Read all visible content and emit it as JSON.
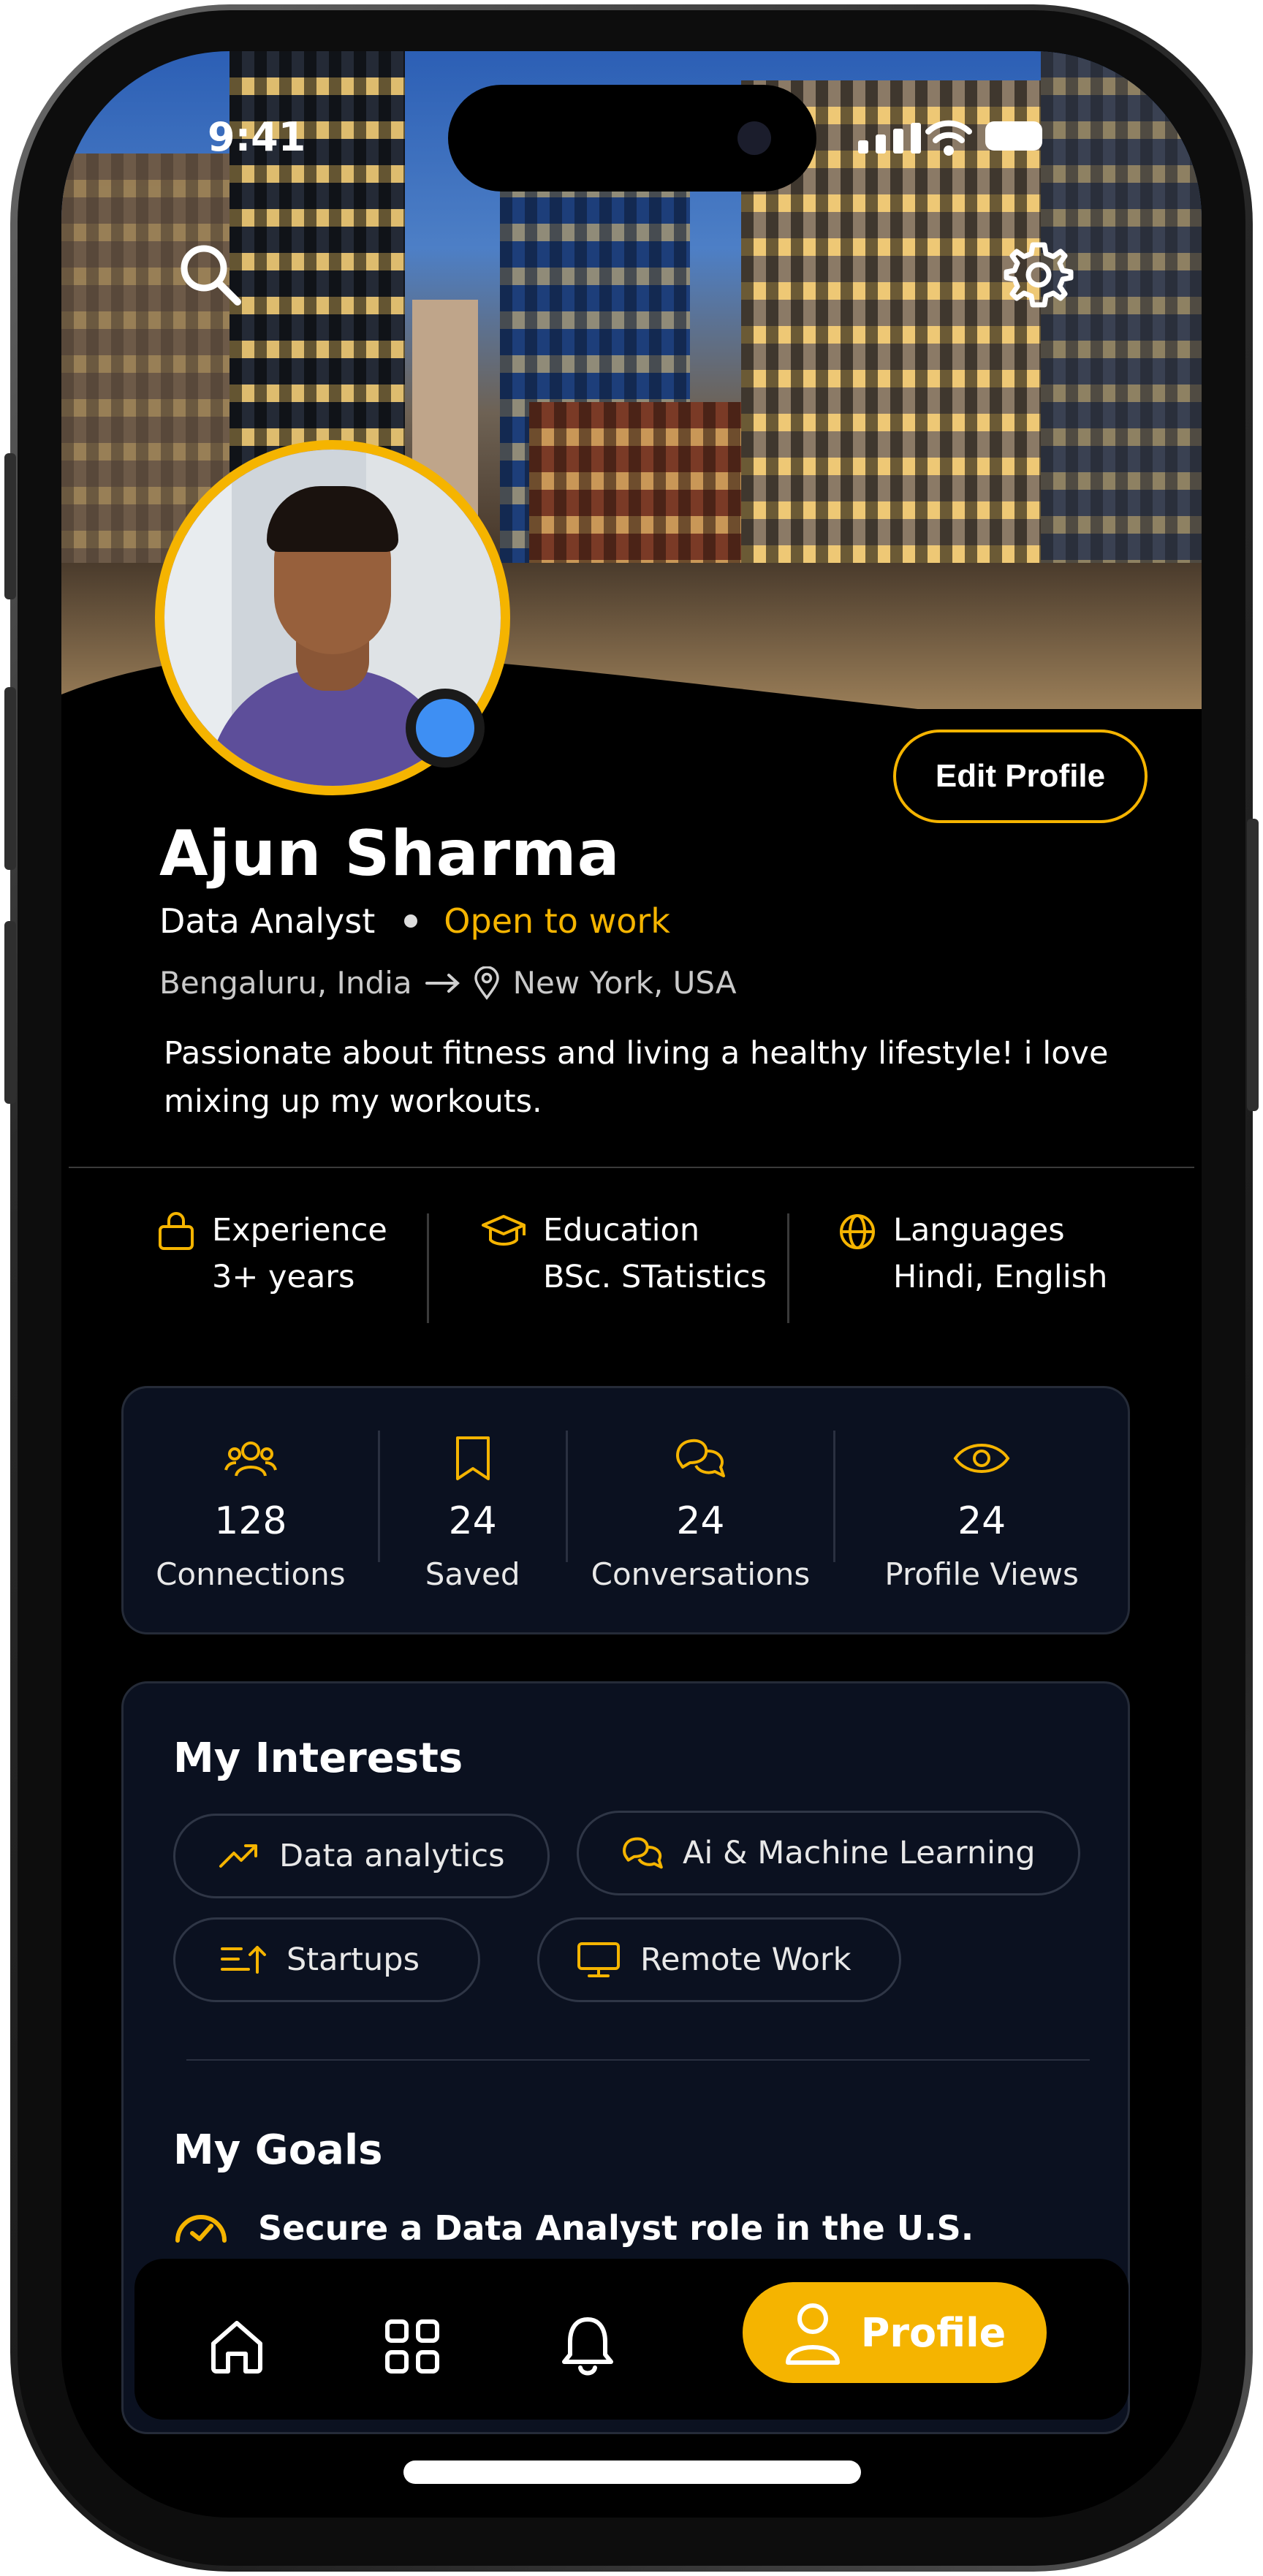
{
  "status_bar": {
    "time": "9:41"
  },
  "header": {
    "search_icon": "search-icon",
    "settings_icon": "gear-icon"
  },
  "profile": {
    "name": "Ajun Sharma",
    "role": "Data Analyst",
    "availability": "Open to work",
    "location_from": "Bengaluru, India",
    "location_to": "New York, USA",
    "bio": "Passionate about fitness and living a healthy lifestyle! i love mixing up my workouts.",
    "edit_label": "Edit Profile",
    "online_color": "#3e8ff3"
  },
  "facts": [
    {
      "title": "Experience",
      "value": "3+ years",
      "icon": "briefcase-icon"
    },
    {
      "title": "Education",
      "value": "BSc. STatistics",
      "icon": "graduation-cap-icon"
    },
    {
      "title": "Languages",
      "value": "Hindi, English",
      "icon": "globe-icon"
    }
  ],
  "stats": [
    {
      "value": "128",
      "label": "Connections",
      "icon": "users-icon"
    },
    {
      "value": "24",
      "label": "Saved",
      "icon": "bookmark-icon"
    },
    {
      "value": "24",
      "label": "Conversations",
      "icon": "chat-icon"
    },
    {
      "value": "24",
      "label": "Profile Views",
      "icon": "eye-icon"
    }
  ],
  "interests": {
    "title": "My Interests",
    "chips": [
      {
        "label": "Data analytics",
        "icon": "trending-up-icon"
      },
      {
        "label": "Ai & Machine Learning",
        "icon": "chat-icon"
      },
      {
        "label": "Startups",
        "icon": "sort-up-icon"
      },
      {
        "label": "Remote Work",
        "icon": "monitor-icon"
      }
    ]
  },
  "goals": {
    "title": "My Goals",
    "items": [
      "Secure a Data Analyst role in the U.S."
    ]
  },
  "nav": {
    "items": [
      {
        "icon": "home-icon"
      },
      {
        "icon": "grid-icon"
      },
      {
        "icon": "bell-icon"
      }
    ],
    "active_label": "Profile"
  },
  "colors": {
    "accent": "#f5b400",
    "card": "#0b1120",
    "background": "#000000"
  }
}
